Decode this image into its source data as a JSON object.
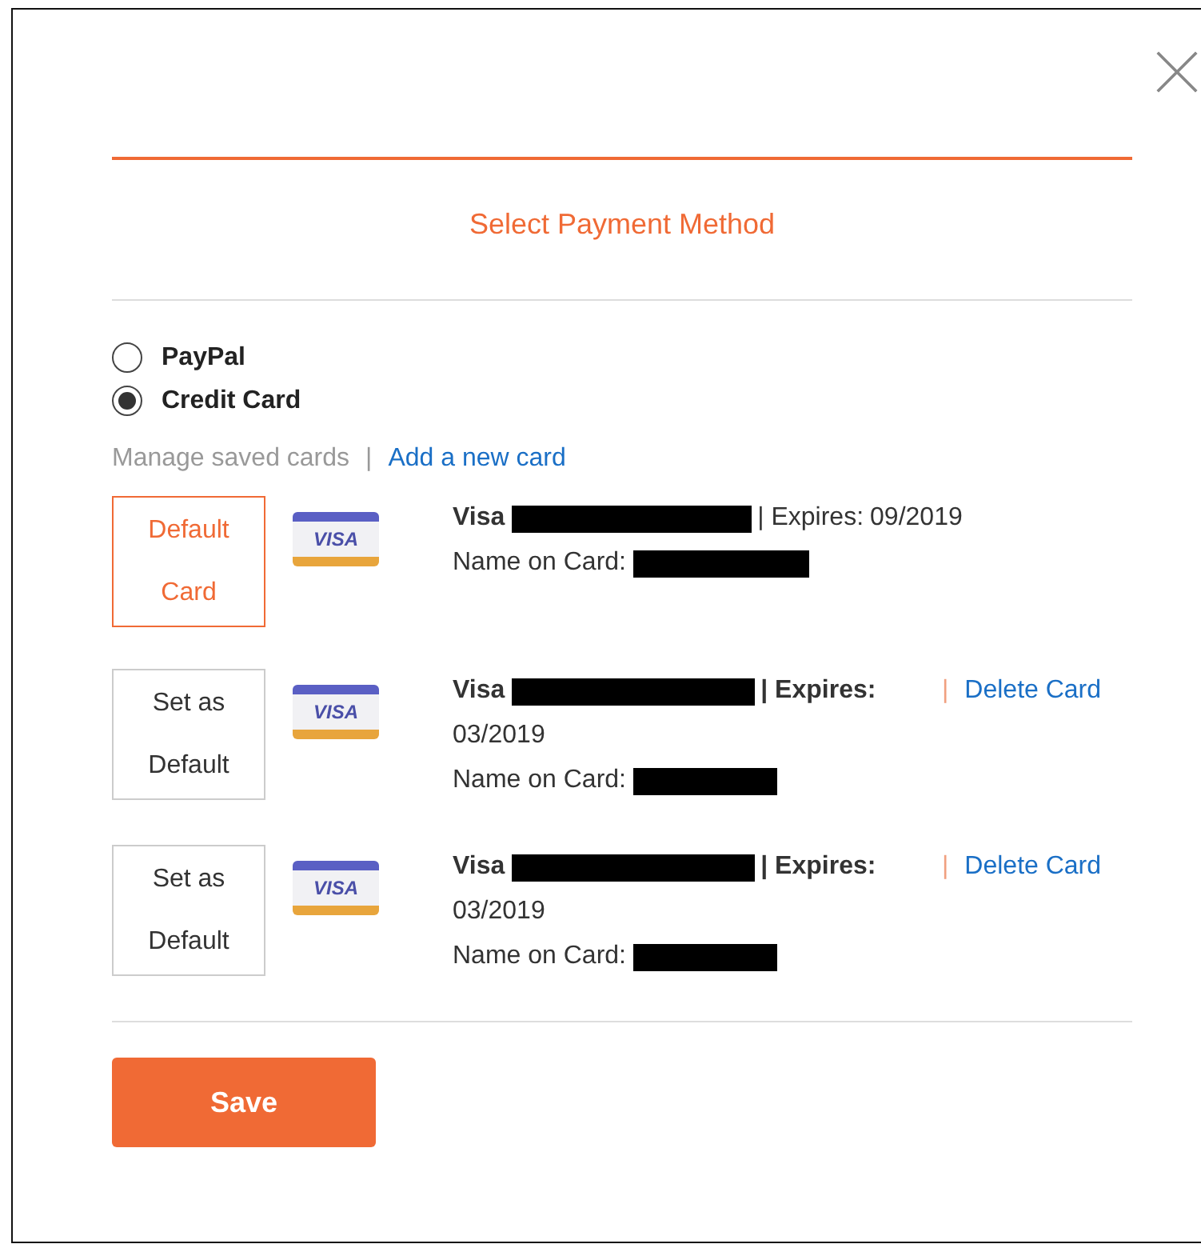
{
  "title": "Select Payment Method",
  "methods": [
    {
      "label": "PayPal",
      "selected": false
    },
    {
      "label": "Credit Card",
      "selected": true
    }
  ],
  "links": {
    "manage": "Manage saved cards",
    "separator": "|",
    "add": "Add a new card"
  },
  "cards": [
    {
      "default": true,
      "button": "Default Card",
      "brand_logo": "VISA",
      "brand": "Visa",
      "expires_label": "| Expires:",
      "expires": "09/2019",
      "name_label": "Name on Card:"
    },
    {
      "default": false,
      "button": "Set as Default",
      "brand_logo": "VISA",
      "brand": "Visa",
      "expires_label": "| Expires:",
      "expires": "03/2019",
      "name_label": "Name on Card:",
      "delete_separator": "|",
      "delete": "Delete Card"
    },
    {
      "default": false,
      "button": "Set as Default",
      "brand_logo": "VISA",
      "brand": "Visa",
      "expires_label": "| Expires:",
      "expires": "03/2019",
      "name_label": "Name on Card:",
      "delete_separator": "|",
      "delete": "Delete Card"
    }
  ],
  "save": "Save"
}
